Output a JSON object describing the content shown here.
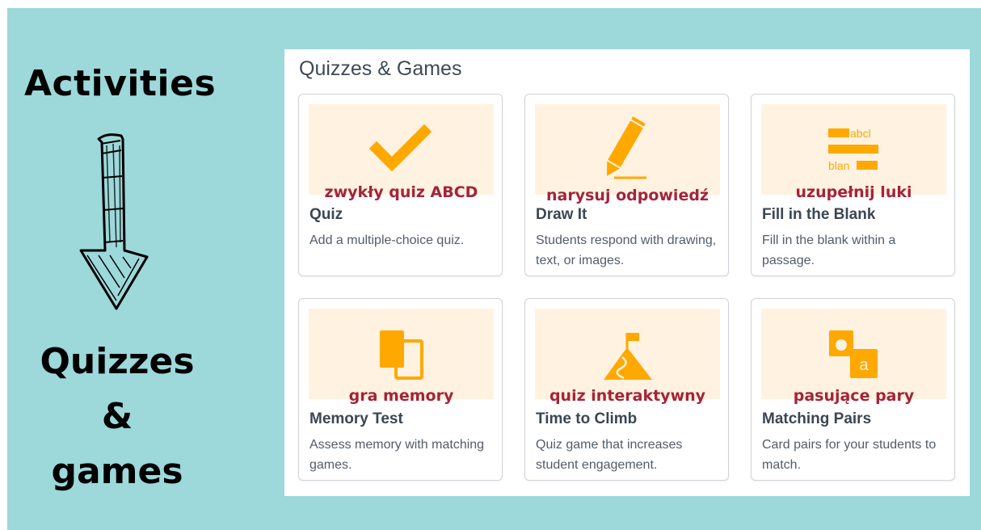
{
  "left": {
    "heading": "Activities",
    "sub_line1": "Quizzes",
    "sub_line2": "&",
    "sub_line3": "games"
  },
  "panel": {
    "title": "Quizzes & Games",
    "cards": [
      {
        "overlay": "zwykły quiz ABCD",
        "name": "Quiz",
        "desc": "Add a multiple-choice quiz.",
        "icon": "checkmark-icon"
      },
      {
        "overlay": "narysuj odpowiedź",
        "name": "Draw It",
        "desc": "Students respond with drawing, text, or images.",
        "icon": "pencil-icon"
      },
      {
        "overlay": "uzupełnij luki",
        "name": "Fill in the Blank",
        "desc": "Fill in the blank within a passage.",
        "icon": "fill-blank-icon",
        "icon_text_1": "abcl",
        "icon_text_2": "blan"
      },
      {
        "overlay": "gra memory",
        "name": "Memory Test",
        "desc": "Assess memory with matching games.",
        "icon": "cards-icon"
      },
      {
        "overlay": "quiz interaktywny",
        "name": "Time to Climb",
        "desc": "Quiz game that increases student engagement.",
        "icon": "mountain-flag-icon"
      },
      {
        "overlay": "pasujące pary",
        "name": "Matching Pairs",
        "desc": "Card pairs for your students to match.",
        "icon": "matching-pairs-icon",
        "icon_text": "a"
      }
    ]
  },
  "colors": {
    "background": "#9dd8da",
    "icon": "#ffa800",
    "thumb": "#fff2e0",
    "overlay_text": "#a3243a"
  }
}
